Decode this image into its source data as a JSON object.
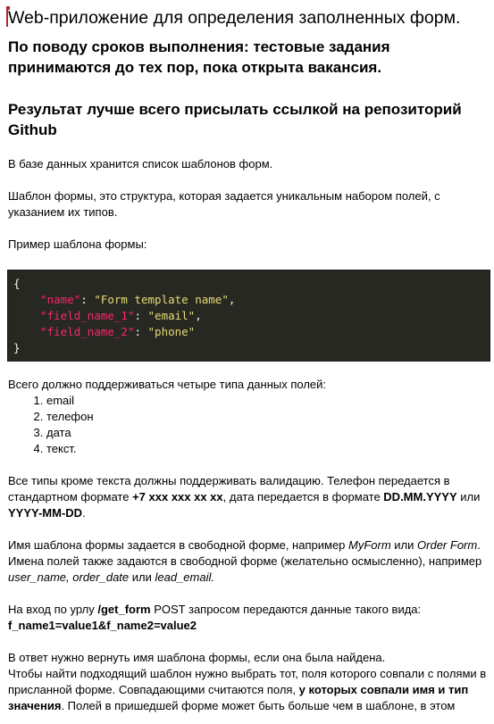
{
  "title": "Web-приложение для определения заполненных форм.",
  "heading_deadline": "По поводу сроков выполнения: тестовые задания принимаются до тех пор, пока открыта вакансия.",
  "heading_result": "Результат лучше всего присылать ссылкой на репозиторий Github",
  "p_db": "В базе данных хранится список шаблонов форм.",
  "p_template": "Шаблон формы, это структура, которая задается уникальным набором полей, с указанием их типов.",
  "p_example": "Пример шаблона формы:",
  "code": {
    "open": "{",
    "k1": "\"name\"",
    "v1": "\"Form template name\"",
    "k2": "\"field_name_1\"",
    "v2": "\"email\"",
    "k3": "\"field_name_2\"",
    "v3": "\"phone\"",
    "close": "}"
  },
  "p_types_intro": "Всего должно поддерживаться четыре типа данных полей:",
  "types": [
    "email",
    "телефон",
    "дата",
    "текст."
  ],
  "validation": {
    "a": "Все типы кроме текста должны поддерживать валидацию. Телефон передается в стандартном формате ",
    "phone_fmt": "+7 xxx xxx xx xx",
    "b": ", дата передается в формате ",
    "date_fmt1": "DD.MM.YYYY",
    "c": " или ",
    "date_fmt2": "YYYY-MM-DD",
    "d": "."
  },
  "names": {
    "a": "Имя шаблона формы задается в свободной форме, например ",
    "ex1": "MyForm",
    "b": " или ",
    "ex2": "Order Form",
    "c": ". Имена полей также задаются в свободной форме (желательно осмысленно), например ",
    "ex3": "user_name, order_date",
    "d": " или ",
    "ex4": "lead_email."
  },
  "input": {
    "a": "На вход по урлу ",
    "url": "/get_form",
    "b": " POST запросом передаются данные такого вида:",
    "data": "f_name1=value1&f_name2=value2"
  },
  "answer": {
    "a": "В ответ нужно вернуть имя шаблона формы, если она была найдена.",
    "b": "Чтобы найти подходящий шаблон нужно выбрать тот, поля которого совпали с полями в присланной форме. Совпадающими считаются поля, ",
    "bold": "у которых совпали имя и тип значения",
    "c": ". Полей в пришедшей форме может быть больше чем в шаблоне, в этом"
  }
}
